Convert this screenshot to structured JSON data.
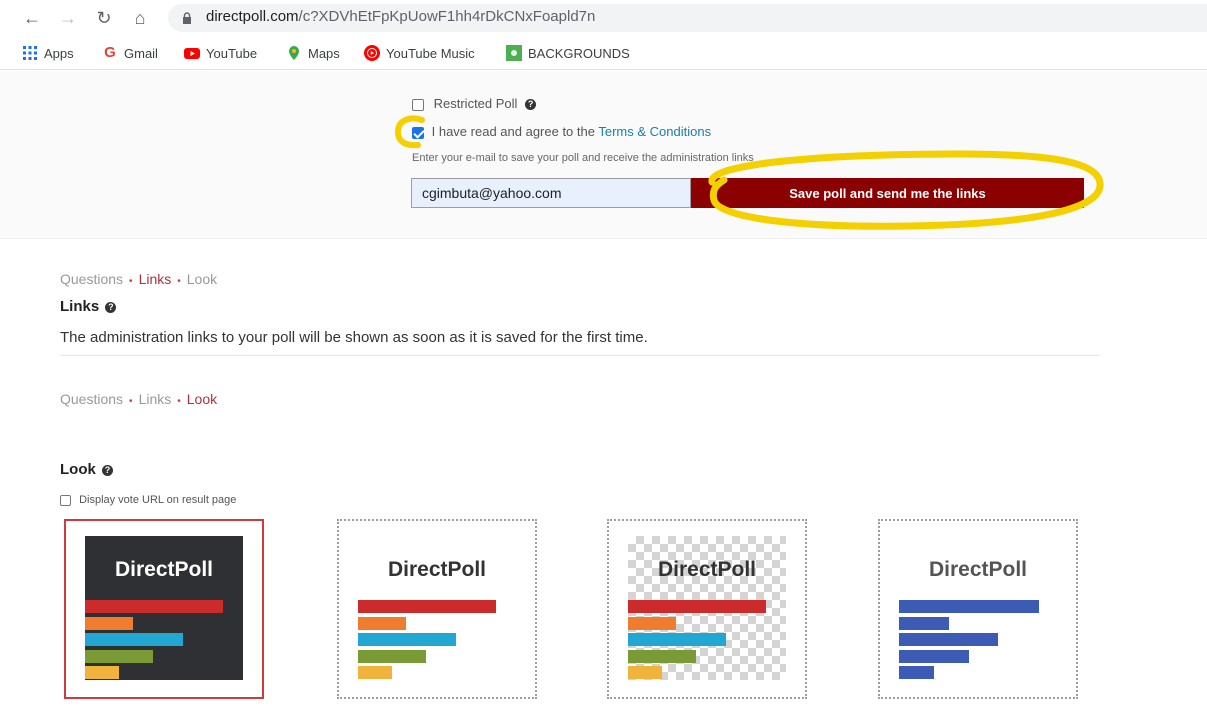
{
  "browser": {
    "url_host": "directpoll.com",
    "url_path": "/c?XDVhEtFpKpUowF1hh4rDkCNxFoapld7n",
    "bookmarks": [
      {
        "label": "Apps",
        "icon": "apps-grid-icon"
      },
      {
        "label": "Gmail",
        "icon": "google-g-icon"
      },
      {
        "label": "YouTube",
        "icon": "youtube-icon"
      },
      {
        "label": "Maps",
        "icon": "maps-pin-icon"
      },
      {
        "label": "YouTube Music",
        "icon": "youtube-music-icon"
      },
      {
        "label": "BACKGROUNDS",
        "icon": "green-bookmark-icon"
      }
    ]
  },
  "form": {
    "restricted_label": "Restricted Poll",
    "restricted_checked": false,
    "agree_prefix": "I have read and agree to the ",
    "agree_link": "Terms & Conditions",
    "agree_checked": true,
    "email_hint": "Enter your e-mail to save your poll and receive the administration links",
    "email_value": "cgimbuta@yahoo.com",
    "save_label": "Save poll and send me the links"
  },
  "steps": [
    "Questions",
    "Links",
    "Look"
  ],
  "links_section": {
    "heading": "Links",
    "text": "The administration links to your poll will be shown as soon as it is saved for the first time."
  },
  "look_section": {
    "heading": "Look",
    "display_url_label": "Display vote URL on result page",
    "display_url_checked": false,
    "themes": [
      {
        "title": "DirectPoll",
        "style": "dark",
        "selected": true
      },
      {
        "title": "DirectPoll",
        "style": "light",
        "selected": false
      },
      {
        "title": "DirectPoll",
        "style": "transparent",
        "selected": false
      },
      {
        "title": "DirectPoll",
        "style": "blue",
        "selected": false
      }
    ]
  },
  "colors": {
    "save_button": "#8b0000",
    "accent_red": "#b03040",
    "link": "#1a7fa8",
    "highlight": "#f5d000"
  }
}
